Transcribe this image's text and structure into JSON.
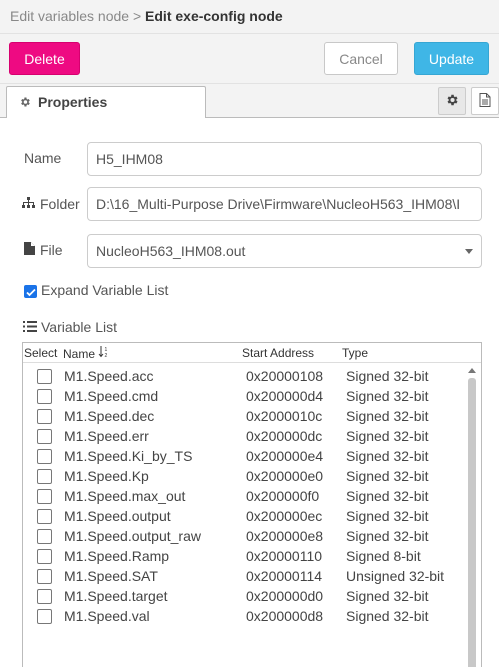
{
  "breadcrumb": {
    "parent": "Edit variables node",
    "separator": ">",
    "current": "Edit exe-config node"
  },
  "toolbar": {
    "delete_label": "Delete",
    "cancel_label": "Cancel",
    "update_label": "Update"
  },
  "tabs": {
    "properties_label": "Properties",
    "icons": [
      "gear-icon",
      "document-icon"
    ]
  },
  "form": {
    "name_label": "Name",
    "name_value": "H5_IHM08",
    "folder_label": "Folder",
    "folder_value": "D:\\16_Multi-Purpose Drive\\Firmware\\NucleoH563_IHM08\\I",
    "file_label": "File",
    "file_value": "NucleoH563_IHM08.out",
    "expand_label": "Expand Variable List",
    "expand_checked": true
  },
  "variable_list": {
    "title": "Variable List",
    "columns": {
      "select": "Select",
      "name": "Name",
      "address": "Start Address",
      "type": "Type"
    },
    "rows": [
      {
        "name": "M1.Speed.acc",
        "address": "0x20000108",
        "type": "Signed 32-bit",
        "selected": false
      },
      {
        "name": "M1.Speed.cmd",
        "address": "0x200000d4",
        "type": "Signed 32-bit",
        "selected": false
      },
      {
        "name": "M1.Speed.dec",
        "address": "0x2000010c",
        "type": "Signed 32-bit",
        "selected": false
      },
      {
        "name": "M1.Speed.err",
        "address": "0x200000dc",
        "type": "Signed 32-bit",
        "selected": false
      },
      {
        "name": "M1.Speed.Ki_by_TS",
        "address": "0x200000e4",
        "type": "Signed 32-bit",
        "selected": false
      },
      {
        "name": "M1.Speed.Kp",
        "address": "0x200000e0",
        "type": "Signed 32-bit",
        "selected": false
      },
      {
        "name": "M1.Speed.max_out",
        "address": "0x200000f0",
        "type": "Signed 32-bit",
        "selected": false
      },
      {
        "name": "M1.Speed.output",
        "address": "0x200000ec",
        "type": "Signed 32-bit",
        "selected": false
      },
      {
        "name": "M1.Speed.output_raw",
        "address": "0x200000e8",
        "type": "Signed 32-bit",
        "selected": false
      },
      {
        "name": "M1.Speed.Ramp",
        "address": "0x20000110",
        "type": "Signed 8-bit",
        "selected": false
      },
      {
        "name": "M1.Speed.SAT",
        "address": "0x20000114",
        "type": "Unsigned 32-bit",
        "selected": false
      },
      {
        "name": "M1.Speed.target",
        "address": "0x200000d0",
        "type": "Signed 32-bit",
        "selected": false
      },
      {
        "name": "M1.Speed.val",
        "address": "0x200000d8",
        "type": "Signed 32-bit",
        "selected": false
      }
    ]
  },
  "colors": {
    "delete": "#ee0a82",
    "update": "#3fb6e6",
    "checkbox": "#1a73e8"
  }
}
